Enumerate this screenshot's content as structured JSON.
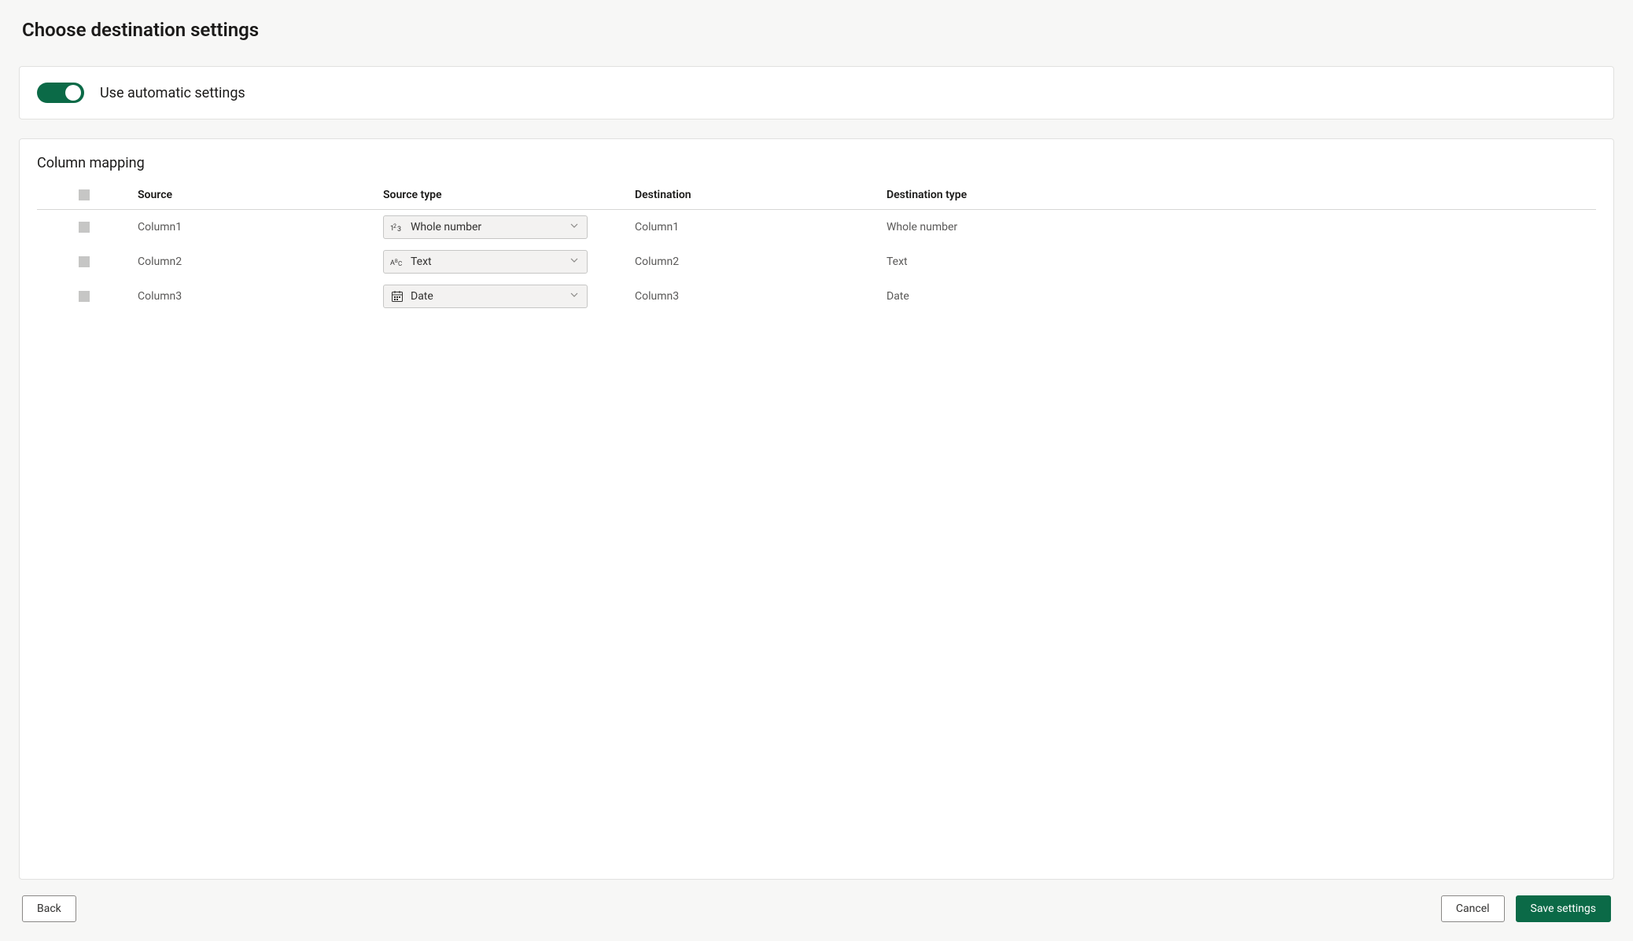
{
  "page": {
    "title": "Choose destination settings"
  },
  "settings": {
    "use_automatic_label": "Use automatic settings"
  },
  "mapping": {
    "title": "Column mapping",
    "headers": {
      "source": "Source",
      "source_type": "Source type",
      "destination": "Destination",
      "destination_type": "Destination type"
    },
    "rows": [
      {
        "source": "Column1",
        "source_type": "Whole number",
        "destination": "Column1",
        "destination_type": "Whole number",
        "icon": "number"
      },
      {
        "source": "Column2",
        "source_type": "Text",
        "destination": "Column2",
        "destination_type": "Text",
        "icon": "text"
      },
      {
        "source": "Column3",
        "source_type": "Date",
        "destination": "Column3",
        "destination_type": "Date",
        "icon": "date"
      }
    ]
  },
  "footer": {
    "back": "Back",
    "cancel": "Cancel",
    "save": "Save settings"
  }
}
